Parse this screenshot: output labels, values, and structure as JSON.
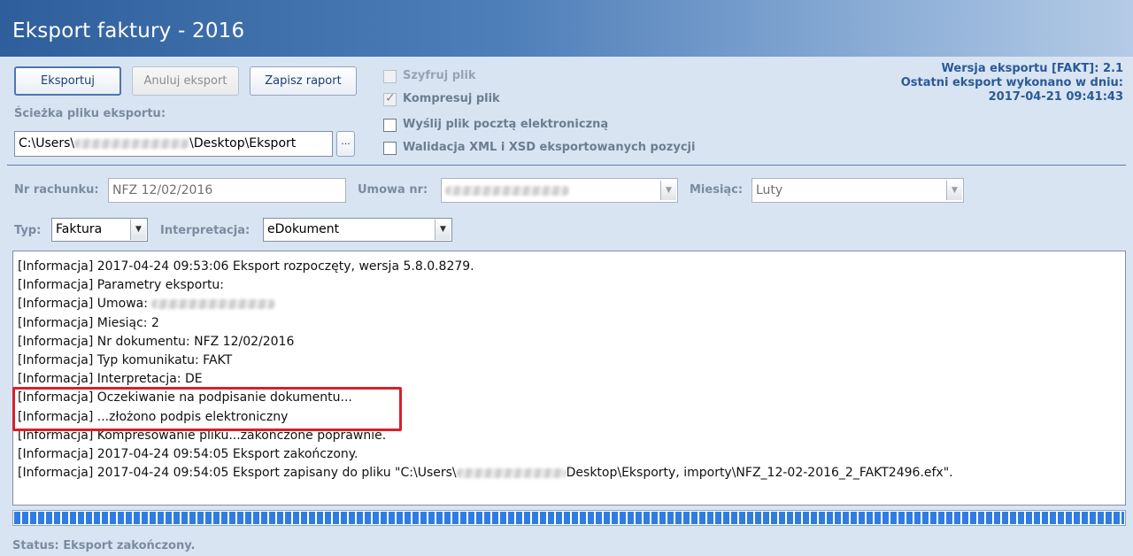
{
  "window": {
    "title": "Eksport faktury - 2016"
  },
  "toolbar": {
    "export_label": "Eksportuj",
    "cancel_label": "Anuluj eksport",
    "save_report_label": "Zapisz raport"
  },
  "path": {
    "label": "Ścieżka pliku eksportu:",
    "prefix": "C:\\Users\\",
    "suffix": "\\Desktop\\Eksport",
    "browse_label": "..."
  },
  "options": {
    "encrypt": {
      "label": "Szyfruj plik",
      "checked": false,
      "enabled": false
    },
    "compress": {
      "label": "Kompresuj plik",
      "checked": true,
      "enabled": false
    },
    "email": {
      "label": "Wyślij plik pocztą elektroniczną",
      "checked": false,
      "enabled": true
    },
    "validate": {
      "label": "Walidacja XML i XSD eksportowanych pozycji",
      "checked": false,
      "enabled": true
    }
  },
  "version_info": {
    "line1": "Wersja eksportu [FAKT]: 2.1",
    "line2": "Ostatni eksport wykonano w dniu:",
    "line3": "2017-04-21 09:41:43"
  },
  "form": {
    "invoice_label": "Nr rachunku:",
    "invoice_value": "NFZ 12/02/2016",
    "contract_label": "Umowa nr:",
    "month_label": "Miesiąc:",
    "month_value": "Luty",
    "type_label": "Typ:",
    "type_value": "Faktura",
    "interpretation_label": "Interpretacja:",
    "interpretation_value": "eDokument"
  },
  "log": [
    "[Informacja] 2017-04-24 09:53:06 Eksport rozpoczęty, wersja 5.8.0.8279.",
    "[Informacja] Parametry eksportu:",
    "[Informacja]   Umowa: ",
    "[Informacja]   Miesiąc: 2",
    "[Informacja]   Nr dokumentu: NFZ 12/02/2016",
    "[Informacja]   Typ komunikatu: FAKT",
    "[Informacja]   Interpretacja: DE",
    "[Informacja] Oczekiwanie na podpisanie dokumentu...",
    "[Informacja] ...złożono podpis elektroniczny",
    "[Informacja] Kompresowanie pliku...zakończone poprawnie.",
    "[Informacja] 2017-04-24 09:54:05 Eksport zakończony.",
    "[Informacja] 2017-04-24 09:54:05 Eksport zapisany do pliku \"C:\\Users\\"
  ],
  "log_last_suffix": "Desktop\\Eksporty, importy\\NFZ_12-02-2016_2_FAKT2496.efx\".",
  "progress": {
    "value": 1.0
  },
  "status": {
    "text": "Status:  Eksport zakończony."
  }
}
